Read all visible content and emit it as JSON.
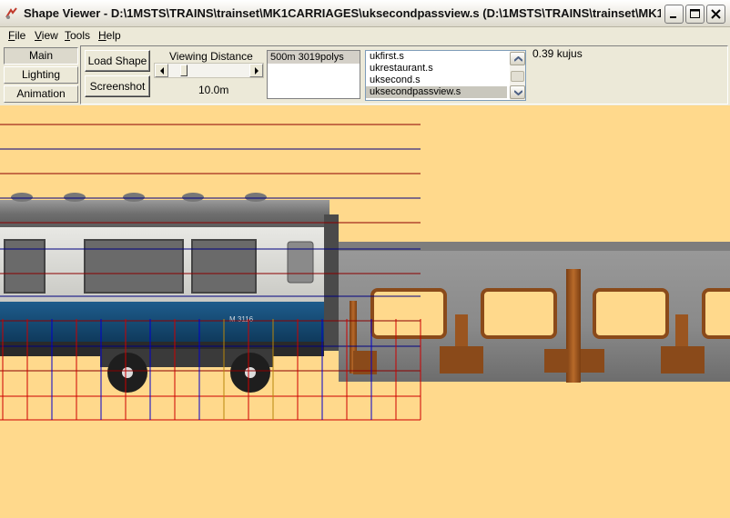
{
  "window": {
    "title": "Shape Viewer - D:\\1MSTS\\TRAINS\\trainset\\MK1CARRIAGES\\uksecondpassview.s (D:\\1MSTS\\TRAINS\\trainset\\MK1..."
  },
  "menu": {
    "file": {
      "key": "F",
      "rest": "ile"
    },
    "view": {
      "key": "V",
      "rest": "iew"
    },
    "tools": {
      "key": "T",
      "rest": "ools"
    },
    "help": {
      "key": "H",
      "rest": "elp"
    }
  },
  "tabs": [
    "Main",
    "Lighting",
    "Animation"
  ],
  "toolbar": {
    "load_shape": "Load Shape",
    "screenshot": "Screenshot",
    "viewing_distance_label": "Viewing Distance",
    "viewing_distance_value": "10.0m",
    "viewing_distance_slider_fraction": 0.15,
    "lod_info": "500m 3019polys",
    "fps": "0.39 kujus"
  },
  "shape_list": {
    "items": [
      "ukfirst.s",
      "ukrestaurant.s",
      "uksecond.s",
      "uksecondpassview.s"
    ],
    "selected": "uksecondpassview.s"
  },
  "viewport": {
    "carriage_number": "M 3116",
    "background_color": "#FFD98C"
  }
}
